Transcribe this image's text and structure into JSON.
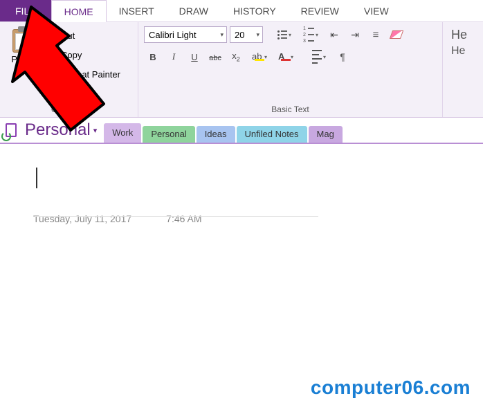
{
  "tabs": {
    "file": "FILE",
    "home": "HOME",
    "insert": "INSERT",
    "draw": "DRAW",
    "history": "HISTORY",
    "review": "REVIEW",
    "view": "VIEW"
  },
  "ribbon": {
    "clipboard": {
      "paste": "Paste",
      "cut": "Cut",
      "copy": "Copy",
      "format_painter": "Format Painter",
      "group_label": "Clipboard"
    },
    "basic_text": {
      "font_name": "Calibri Light",
      "font_size": "20",
      "group_label": "Basic Text"
    },
    "styles": {
      "heading1": "He",
      "heading2": "He"
    }
  },
  "notebook": {
    "name": "Personal",
    "sections": {
      "work": "Work",
      "personal": "Personal",
      "ideas": "Ideas",
      "unfiled": "Unfiled Notes",
      "mag": "Mag"
    }
  },
  "page": {
    "date": "Tuesday, July 11, 2017",
    "time": "7:46 AM"
  },
  "watermark": "computer06.com"
}
